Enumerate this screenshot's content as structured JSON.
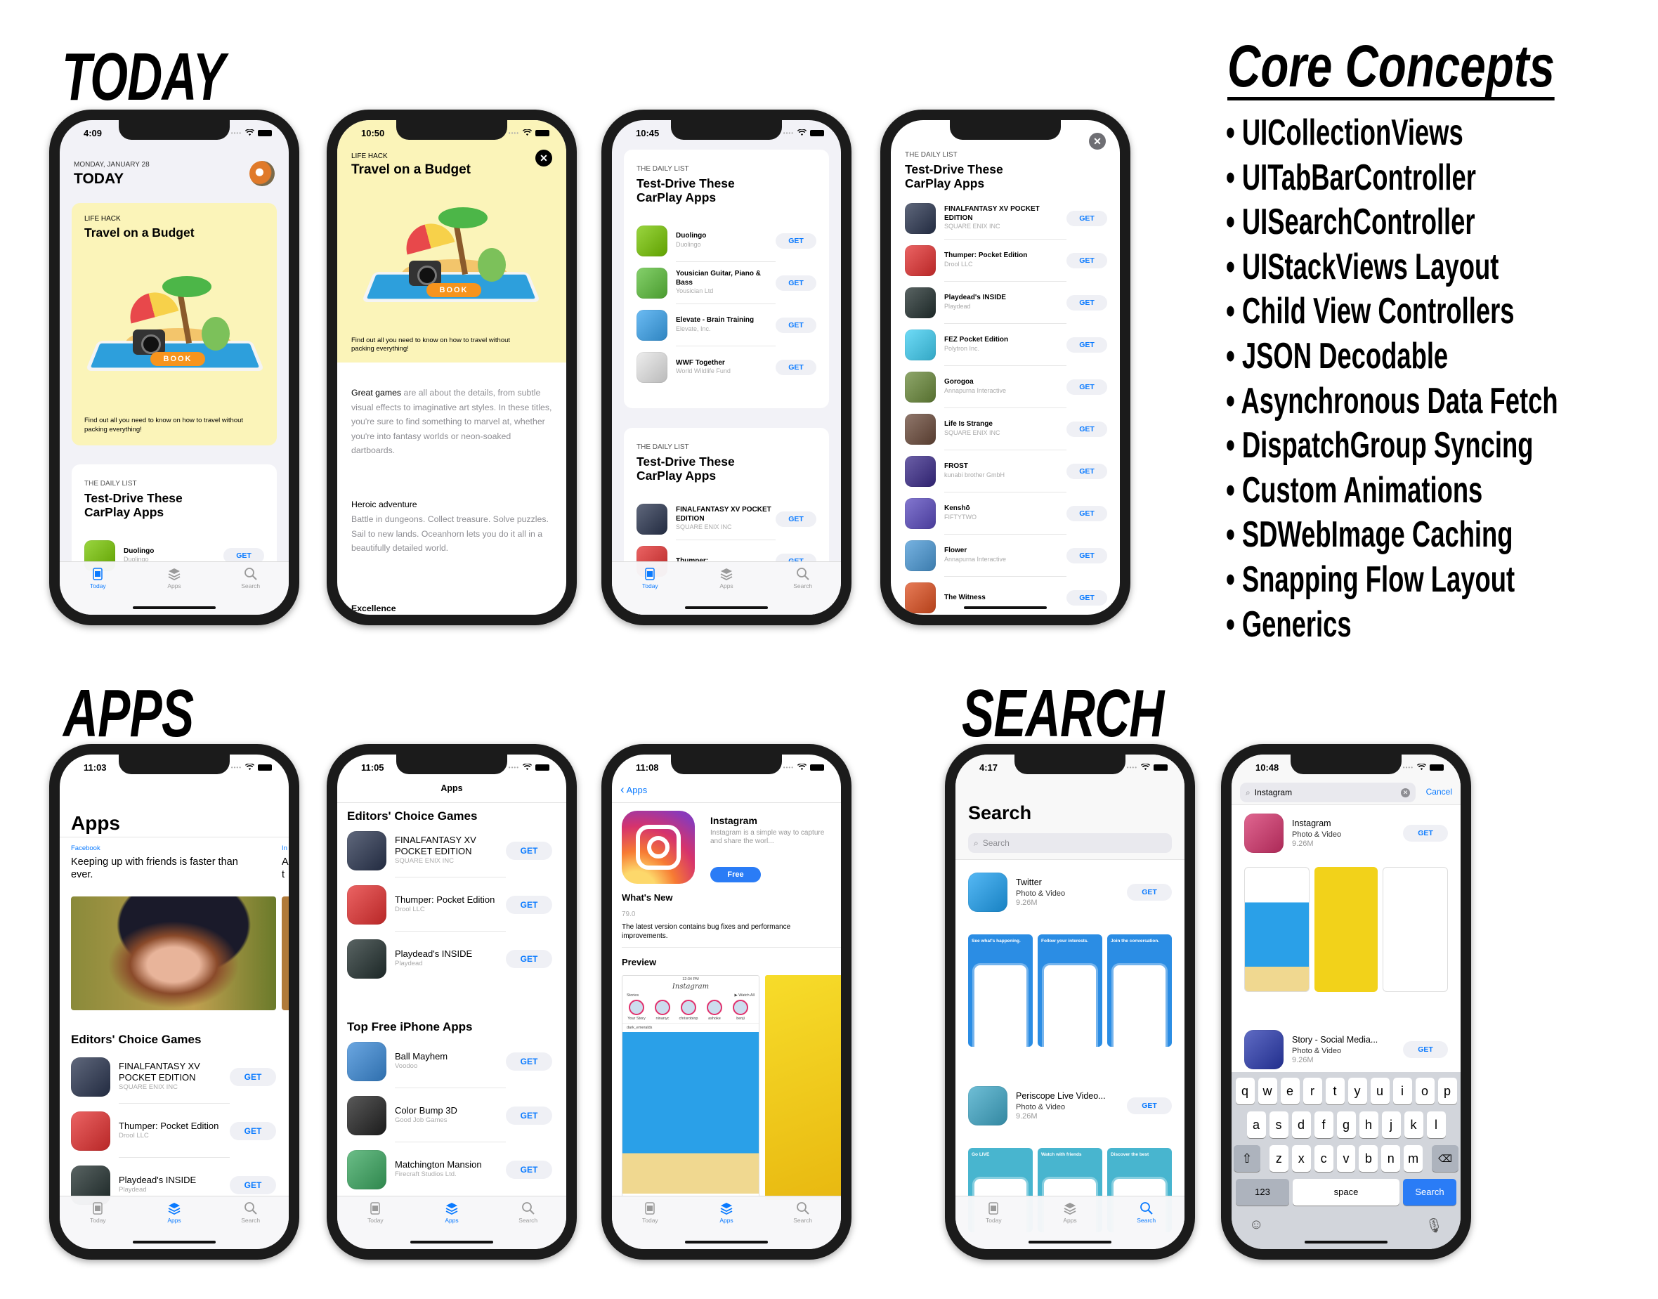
{
  "headings": {
    "today": "TODAY",
    "apps": "APPS",
    "search": "SEARCH",
    "core_concepts": "Core Concepts"
  },
  "core_concepts": [
    "UICollectionViews",
    "UITabBarController",
    "UISearchController",
    "UIStackViews Layout",
    "Child View Controllers",
    "JSON Decodable",
    "Asynchronous Data Fetch",
    "DispatchGroup Syncing",
    "Custom Animations",
    "SDWebImage Caching",
    "Snapping Flow Layout",
    "Generics"
  ],
  "colors": {
    "accent": "#0a7aff",
    "get_bg": "#eff0f5",
    "card_yellow": "#fbf4b9",
    "gray_bg": "#f2f2f7"
  },
  "common": {
    "get_label": "GET"
  },
  "tabbar": {
    "today": "Today",
    "apps": "Apps",
    "search": "Search"
  },
  "phones": {
    "today_feed": {
      "time": "4:09",
      "date": "MONDAY, JANUARY 28",
      "title": "TODAY",
      "card1": {
        "category": "LIFE HACK",
        "title": "Travel on a Budget",
        "book_label": "BOOK",
        "description": "Find out all you need to know on how to travel without packing everything!"
      },
      "card2": {
        "category": "THE DAILY LIST",
        "title": "Test-Drive These CarPlay Apps",
        "apps": [
          {
            "name": "Duolingo",
            "developer": "Duolingo",
            "icon_color": "#78c800"
          }
        ]
      }
    },
    "today_detail": {
      "time": "10:50",
      "category": "LIFE HACK",
      "title": "Travel on a Budget",
      "book_label": "BOOK",
      "description": "Find out all you need to know on how to travel without packing everything!",
      "p1_lead": "Great games",
      "p1_text": " are all about the details, from subtle visual effects to imaginative art styles. In these titles, you're sure to find something to marvel at, whether you're into fantasy worlds or neon-soaked dartboards.",
      "p2_heading": "Heroic adventure",
      "p2_text": "Battle in dungeons. Collect treasure. Solve puzzles. Sail to new lands. Oceanhorn lets you do it all in a beautifully detailed world.",
      "p3_heading": "Excellence"
    },
    "daily_feed": {
      "time": "10:45",
      "card1": {
        "category": "THE DAILY LIST",
        "title": "Test-Drive These CarPlay Apps",
        "apps": [
          {
            "name": "Duolingo",
            "developer": "Duolingo",
            "icon_color": "#78c800"
          },
          {
            "name": "Yousician Guitar, Piano & Bass",
            "developer": "Yousician Ltd",
            "icon_color": "#5cc13a"
          },
          {
            "name": "Elevate - Brain Training",
            "developer": "Elevate, Inc.",
            "icon_color": "#3aa5f0"
          },
          {
            "name": "WWF Together",
            "developer": "World Wildlife Fund",
            "icon_color": "#e8e8e8"
          }
        ]
      },
      "card2": {
        "category": "THE DAILY LIST",
        "title": "Test-Drive These CarPlay Apps",
        "apps": [
          {
            "name": "FINALFANTASY XV POCKET EDITION",
            "developer": "SQUARE ENIX INC",
            "icon_color": "#2a3550"
          },
          {
            "name": "Thumper:",
            "developer": "",
            "icon_color": "#e53030"
          }
        ]
      }
    },
    "daily_detail": {
      "category": "THE DAILY LIST",
      "title": "Test-Drive These CarPlay Apps",
      "close": "✕",
      "apps": [
        {
          "name": "FINALFANTASY XV POCKET EDITION",
          "developer": "SQUARE ENIX INC",
          "icon_color": "#2a3550"
        },
        {
          "name": "Thumper: Pocket Edition",
          "developer": "Drool LLC",
          "icon_color": "#e53030"
        },
        {
          "name": "Playdead's INSIDE",
          "developer": "Playdead",
          "icon_color": "#22302f"
        },
        {
          "name": "FEZ Pocket Edition",
          "developer": "Polytron Inc.",
          "icon_color": "#3fd0f5"
        },
        {
          "name": "Gorogoa",
          "developer": "Annapurna Interactive",
          "icon_color": "#6a8a3a"
        },
        {
          "name": "Life Is Strange",
          "developer": "SQUARE ENIX INC",
          "icon_color": "#6b4a3a"
        },
        {
          "name": "FROST",
          "developer": "kunabi brother GmbH",
          "icon_color": "#3a2a8a"
        },
        {
          "name": "Kenshō",
          "developer": "FIFTYTWO",
          "icon_color": "#5a4ac0"
        },
        {
          "name": "Flower",
          "developer": "Annapurna Interactive",
          "icon_color": "#4a9ad8"
        },
        {
          "name": "The Witness",
          "developer": "",
          "icon_color": "#e05020"
        }
      ]
    },
    "apps_home": {
      "time": "11:03",
      "title": "Apps",
      "featured": {
        "company": "Facebook",
        "headline": "Keeping up with friends is faster than ever.",
        "peek_company": "In",
        "peek_headline": "A t"
      },
      "section": "Editors' Choice Games",
      "apps": [
        {
          "name": "FINALFANTASY XV POCKET EDITION",
          "developer": "SQUARE ENIX INC",
          "icon_color": "#2a3550"
        },
        {
          "name": "Thumper: Pocket Edition",
          "developer": "Drool LLC",
          "icon_color": "#e53030"
        },
        {
          "name": "Playdead's INSIDE",
          "developer": "Playdead",
          "icon_color": "#22302f"
        }
      ]
    },
    "apps_group": {
      "time": "11:05",
      "nav_title": "Apps",
      "section1": "Editors' Choice Games",
      "apps1": [
        {
          "name": "FINALFANTASY XV POCKET EDITION",
          "developer": "SQUARE ENIX INC",
          "icon_color": "#2a3550"
        },
        {
          "name": "Thumper: Pocket Edition",
          "developer": "Drool LLC",
          "icon_color": "#e53030"
        },
        {
          "name": "Playdead's INSIDE",
          "developer": "Playdead",
          "icon_color": "#22302f"
        }
      ],
      "section2": "Top Free iPhone Apps",
      "apps2": [
        {
          "name": "Ball Mayhem",
          "developer": "Voodoo",
          "icon_color": "#3a8ad8"
        },
        {
          "name": "Color Bump 3D",
          "developer": "Good Job Games",
          "icon_color": "#222222"
        },
        {
          "name": "Matchington Mansion",
          "developer": "Firecraft Studios Ltd.",
          "icon_color": "#3aa860"
        }
      ]
    },
    "app_detail": {
      "time": "11:08",
      "back": "Apps",
      "name": "Instagram",
      "description": "Instagram is a simple way to capture and share the worl...",
      "price": "Free",
      "whats_new": "What's New",
      "version": "79.0",
      "notes": "The latest version contains bug fixes and performance improvements.",
      "preview": "Preview",
      "shot": {
        "time": "12:34 PM",
        "logo": "Instagram",
        "stories": "Stories",
        "watch_all": "▶ Watch All",
        "users": [
          "Your Story",
          "ninanyc",
          "chrisrobinp",
          "ashoke",
          "benji"
        ],
        "post_user": "dark_emeralds"
      }
    },
    "search_home": {
      "time": "4:17",
      "title": "Search",
      "placeholder": "Search",
      "results": [
        {
          "name": "Twitter",
          "category": "Photo & Video",
          "size": "9.26M",
          "icon_color": "#1da1f2",
          "tile_color": "#2b8de4",
          "tiles": [
            "See what's happening.",
            "Follow your interests.",
            "Join the conversation."
          ]
        },
        {
          "name": "Periscope Live Video...",
          "category": "Photo & Video",
          "size": "9.26M",
          "icon_color": "#3fa9c9",
          "tile_color": "#48b5cf",
          "tiles": [
            "Go LIVE",
            "Watch with friends",
            "Discover the best"
          ]
        }
      ]
    },
    "search_results": {
      "time": "10:48",
      "query": "Instagram",
      "cancel": "Cancel",
      "results": [
        {
          "name": "Instagram",
          "category": "Photo & Video",
          "size": "9.26M",
          "icon_color": "#d6336c"
        },
        {
          "name": "Story - Social Media...",
          "category": "Photo & Video",
          "size": "9.26M",
          "icon_color": "#2a3ab0"
        }
      ],
      "keyboard": {
        "row1": [
          "q",
          "w",
          "e",
          "r",
          "t",
          "y",
          "u",
          "i",
          "o",
          "p"
        ],
        "row2": [
          "a",
          "s",
          "d",
          "f",
          "g",
          "h",
          "j",
          "k",
          "l"
        ],
        "row3": [
          "z",
          "x",
          "c",
          "v",
          "b",
          "n",
          "m"
        ],
        "numbers": "123",
        "space": "space",
        "search": "Search"
      }
    }
  }
}
